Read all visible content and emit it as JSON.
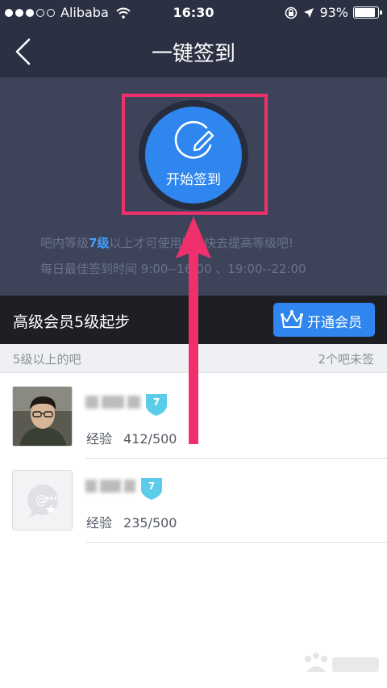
{
  "status_bar": {
    "carrier": "Alibaba",
    "time": "16:30",
    "battery": "93%",
    "battery_level": 0.93
  },
  "nav": {
    "title": "一键签到",
    "back_icon": "chevron-left-icon"
  },
  "sign_in": {
    "button_label": "开始签到",
    "icon": "pen-circle-icon",
    "hint_line1_pre": "吧内等级",
    "hint_line1_em": "7级",
    "hint_line1_post": "以上才可使用哦~快去提高等级吧!",
    "hint_line2": "每日最佳签到时间  9:00--16:00 、19:00--22:00"
  },
  "vip": {
    "text": "高级会员5级起步",
    "button_label": "开通会员",
    "button_icon": "crown-icon"
  },
  "list_header": {
    "left": "5级以上的吧",
    "right": "2个吧未签"
  },
  "forums": [
    {
      "level": "7",
      "exp_label": "经验",
      "exp_value": "412/500",
      "avatar": "user-photo"
    },
    {
      "level": "7",
      "exp_label": "经验",
      "exp_value": "235/500",
      "avatar": "chat-bubble-placeholder-icon"
    }
  ],
  "colors": {
    "nav_bg": "#2b3143",
    "hero_bg": "#3d4459",
    "accent_blue": "#2e86ee",
    "annotation_pink": "#f0306c",
    "badge_cyan": "#5ccde8"
  }
}
